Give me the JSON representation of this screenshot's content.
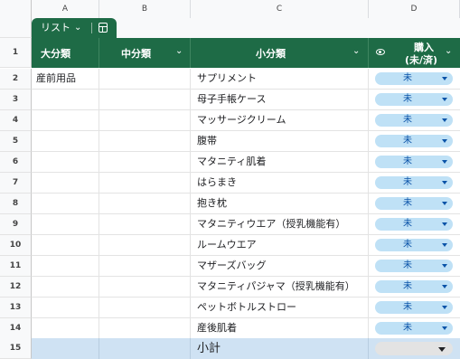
{
  "columns": [
    "A",
    "B",
    "C",
    "D"
  ],
  "table_tab": {
    "name": "リスト"
  },
  "header": {
    "row_number": "1",
    "col_a": "大分類",
    "col_b": "中分類",
    "col_c": "小分類",
    "col_d_line1": "購入",
    "col_d_line2": "(未/済)"
  },
  "rows": [
    {
      "num": "2",
      "a": "産前用品",
      "c": "サプリメント",
      "status": "未"
    },
    {
      "num": "3",
      "a": "",
      "c": "母子手帳ケース",
      "status": "未"
    },
    {
      "num": "4",
      "a": "",
      "c": "マッサージクリーム",
      "status": "未"
    },
    {
      "num": "5",
      "a": "",
      "c": "腹帯",
      "status": "未"
    },
    {
      "num": "6",
      "a": "",
      "c": "マタニティ肌着",
      "status": "未"
    },
    {
      "num": "7",
      "a": "",
      "c": "はらまき",
      "status": "未"
    },
    {
      "num": "8",
      "a": "",
      "c": "抱き枕",
      "status": "未"
    },
    {
      "num": "9",
      "a": "",
      "c": "マタニティウエア（授乳機能有）",
      "status": "未"
    },
    {
      "num": "10",
      "a": "",
      "c": "ルームウエア",
      "status": "未"
    },
    {
      "num": "11",
      "a": "",
      "c": "マザーズバッグ",
      "status": "未"
    },
    {
      "num": "12",
      "a": "",
      "c": "マタニティパジャマ（授乳機能有）",
      "status": "未"
    },
    {
      "num": "13",
      "a": "",
      "c": "ペットボトルストロー",
      "status": "未"
    },
    {
      "num": "14",
      "a": "",
      "c": "産後肌着",
      "status": "未"
    }
  ],
  "subtotal": {
    "num": "15",
    "label": "小計"
  },
  "colors": {
    "header_green": "#1e6b46",
    "chip_blue": "#bfe1f6",
    "chip_text": "#0a53a8",
    "subtotal_bg": "#cfe2f3"
  },
  "icons": {
    "tab_menu": "chevron-down-icon",
    "tab_view": "table-grid-icon",
    "filter": "chevron-down-icon",
    "visibility": "eye-icon",
    "dropdown": "caret-down-icon"
  }
}
